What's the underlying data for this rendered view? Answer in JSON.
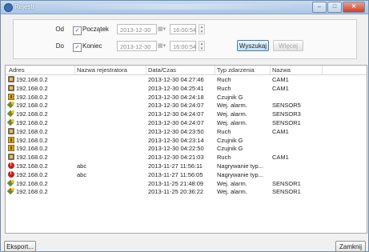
{
  "window": {
    "title": "Rejestr",
    "buttons": {
      "minimize": "–",
      "maximize": "□",
      "close": "✕"
    }
  },
  "filters": {
    "from": {
      "label": "Od",
      "checkbox_label": "Początek",
      "checked": true,
      "date": "2013-12-30",
      "time": "16:00:54"
    },
    "to": {
      "label": "Do",
      "checkbox_label": "Koniec",
      "checked": true,
      "date": "2013-12-30",
      "time": "16:00:54"
    },
    "search_button": "Wyszukaj",
    "more_button": "Więcej"
  },
  "table": {
    "columns": [
      "Adres",
      "Nazwa rejestratora",
      "Data/Czas",
      "Typ zdarzenia",
      "Nazwa"
    ],
    "rows": [
      {
        "icon": "motion-icon",
        "address": "192.168.0.2",
        "recorder": "",
        "datetime": "2013-12-30 04:27:46",
        "type": "Ruch",
        "name": "CAM1"
      },
      {
        "icon": "motion-icon",
        "address": "192.168.0.2",
        "recorder": "",
        "datetime": "2013-12-30 04:25:41",
        "type": "Ruch",
        "name": "CAM1"
      },
      {
        "icon": "sensor-icon",
        "address": "192.168.0.2",
        "recorder": "",
        "datetime": "2013-12-30 04:24:18",
        "type": "Czujnik G",
        "name": ""
      },
      {
        "icon": "alarm-input-icon",
        "address": "192.168.0.2",
        "recorder": "",
        "datetime": "2013-12-30 04:24:07",
        "type": "Wej. alarm.",
        "name": "SENSOR5"
      },
      {
        "icon": "alarm-input-icon",
        "address": "192.168.0.2",
        "recorder": "",
        "datetime": "2013-12-30 04:24:07",
        "type": "Wej. alarm.",
        "name": "SENSOR3"
      },
      {
        "icon": "alarm-input-icon",
        "address": "192.168.0.2",
        "recorder": "",
        "datetime": "2013-12-30 04:24:07",
        "type": "Wej. alarm.",
        "name": "SENSOR1"
      },
      {
        "icon": "motion-icon",
        "address": "192.168.0.2",
        "recorder": "",
        "datetime": "2013-12-30 04:23:50",
        "type": "Ruch",
        "name": "CAM1"
      },
      {
        "icon": "sensor-icon",
        "address": "192.168.0.2",
        "recorder": "",
        "datetime": "2013-12-30 04:23:14",
        "type": "Czujnik G",
        "name": ""
      },
      {
        "icon": "sensor-icon",
        "address": "192.168.0.2",
        "recorder": "",
        "datetime": "2013-12-30 04:22:50",
        "type": "Czujnik G",
        "name": ""
      },
      {
        "icon": "motion-icon",
        "address": "192.168.0.2",
        "recorder": "",
        "datetime": "2013-12-30 04:21:03",
        "type": "Ruch",
        "name": "CAM1"
      },
      {
        "icon": "recording-error-icon",
        "address": "192.168.0.2",
        "recorder": "abc",
        "datetime": "2013-11-27 11:56:11",
        "type": "Nagrywanie typ...",
        "name": ""
      },
      {
        "icon": "recording-error-icon",
        "address": "192.168.0.2",
        "recorder": "abc",
        "datetime": "2013-11-27 11:56:05",
        "type": "Nagrywanie typ...",
        "name": ""
      },
      {
        "icon": "alarm-input-icon",
        "address": "192.168.0.2",
        "recorder": "",
        "datetime": "2013-11-25 21:48:09",
        "type": "Wej. alarm.",
        "name": "SENSOR1"
      },
      {
        "icon": "alarm-input-icon",
        "address": "192.168.0.2",
        "recorder": "",
        "datetime": "2013-11-25 20:36:22",
        "type": "Wej. alarm.",
        "name": "SENSOR1"
      }
    ]
  },
  "footer": {
    "export_button": "Eksport...",
    "close_button": "Zamknij"
  }
}
